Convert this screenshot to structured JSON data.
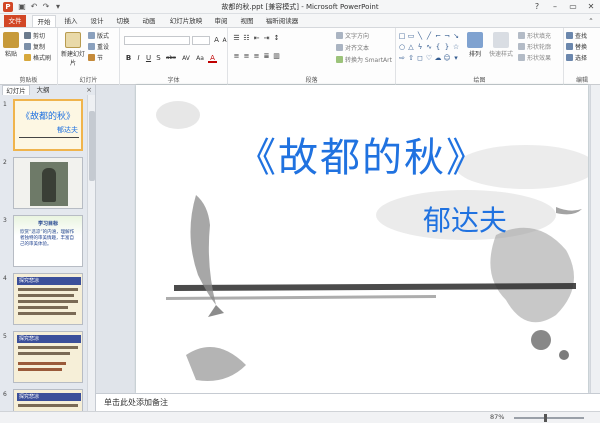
{
  "window": {
    "title": "故都的秋.ppt [兼容模式] - Microsoft PowerPoint"
  },
  "ribbon_tabs": [
    "文件",
    "开始",
    "插入",
    "设计",
    "切换",
    "动画",
    "幻灯片放映",
    "审阅",
    "视图",
    "福昕阅读器"
  ],
  "clipboard": {
    "paste": "粘贴",
    "cut": "剪切",
    "copy": "复制",
    "format_painter": "格式刷",
    "label": "剪贴板"
  },
  "slides_group": {
    "new_slide": "新建幻灯片",
    "layout": "版式",
    "reset": "重设",
    "section": "节",
    "label": "幻灯片"
  },
  "font_group": {
    "label": "字体",
    "size_up": "A",
    "size_down": "A",
    "bold": "B",
    "italic": "I",
    "underline": "U",
    "shadow": "S",
    "strike": "abc",
    "spacing": "AV",
    "case": "Aa",
    "color": "A"
  },
  "paragraph_group": {
    "label": "段落",
    "text_direction": "文字方向",
    "align_text": "对齐文本",
    "smartart": "转换为 SmartArt"
  },
  "drawing_group": {
    "label": "绘图",
    "arrange": "排列",
    "quick_styles": "快速样式",
    "shape_fill": "形状填充",
    "shape_outline": "形状轮廓",
    "shape_effects": "形状效果"
  },
  "editing_group": {
    "label": "编辑",
    "find": "查找",
    "replace": "替换",
    "select": "选择"
  },
  "panel_tabs": {
    "slides": "幻灯片",
    "outline": "大纲",
    "close": "×"
  },
  "thumbnails": [
    {
      "num": "1",
      "title": "《故都的秋》",
      "subtitle": "郁达夫"
    },
    {
      "num": "2"
    },
    {
      "num": "3",
      "heading": "学习目标",
      "text": "欣赏“悲凉”的内涵，理解作者独特的审美情趣，丰富自己的审美体验。"
    },
    {
      "num": "4",
      "heading": "探究悲凉"
    },
    {
      "num": "5",
      "heading": "探究悲凉"
    },
    {
      "num": "6",
      "heading": "探究悲凉"
    }
  ],
  "slide": {
    "title": "《故都的秋》",
    "author": "郁达夫"
  },
  "notes": {
    "placeholder": "单击此处添加备注"
  },
  "status": {
    "zoom": "87%",
    "zoom_level": 0.87
  },
  "colors": {
    "accent": "#d24726",
    "title_blue": "#2072e0",
    "selection": "#f0b44c"
  }
}
